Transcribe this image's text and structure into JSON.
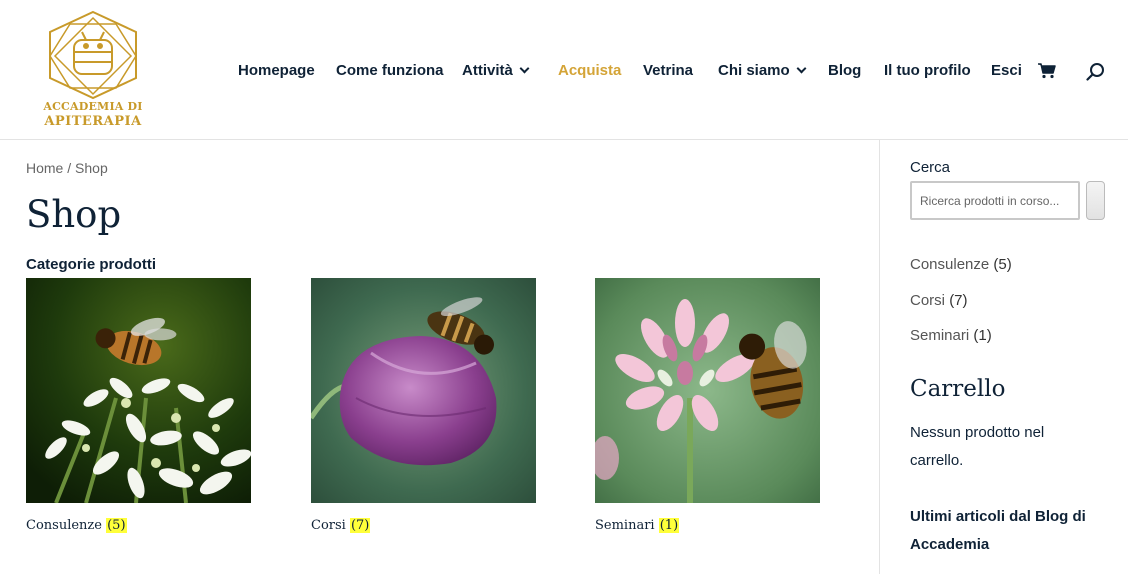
{
  "logo": {
    "line1": "ACCADEMIA DI",
    "line2": "APITERAPIA"
  },
  "nav": {
    "items": [
      {
        "label": "Homepage"
      },
      {
        "label": "Come funziona"
      },
      {
        "label": "Attività"
      },
      {
        "label": "Acquista"
      },
      {
        "label": "Vetrina"
      },
      {
        "label": "Chi siamo"
      },
      {
        "label": "Blog"
      },
      {
        "label": "Il tuo profilo"
      },
      {
        "label": "Esci"
      }
    ],
    "active_item": "Acquista"
  },
  "breadcrumb": {
    "home": "Home",
    "separator": " / ",
    "current": "Shop"
  },
  "page_title": "Shop",
  "categories": {
    "heading": "Categorie prodotti",
    "items": [
      {
        "name": "Consulenze",
        "count": "(5)"
      },
      {
        "name": "Corsi",
        "count": "(7)"
      },
      {
        "name": "Seminari",
        "count": "(1)"
      }
    ]
  },
  "sidebar": {
    "search_label": "Cerca",
    "search_placeholder": "Ricerca prodotti in corso...",
    "categories": [
      {
        "name": "Consulenze",
        "count": "(5)"
      },
      {
        "name": "Corsi",
        "count": "(7)"
      },
      {
        "name": "Seminari",
        "count": "(1)"
      }
    ],
    "cart_title": "Carrello",
    "cart_empty": "Nessun prodotto nel carrello.",
    "blog_title": "Ultimi articoli dal Blog di Accademia"
  },
  "colors": {
    "brand_gold": "#d4a437",
    "text_navy": "#0f2236",
    "count_highlight": "#ffff3a"
  }
}
